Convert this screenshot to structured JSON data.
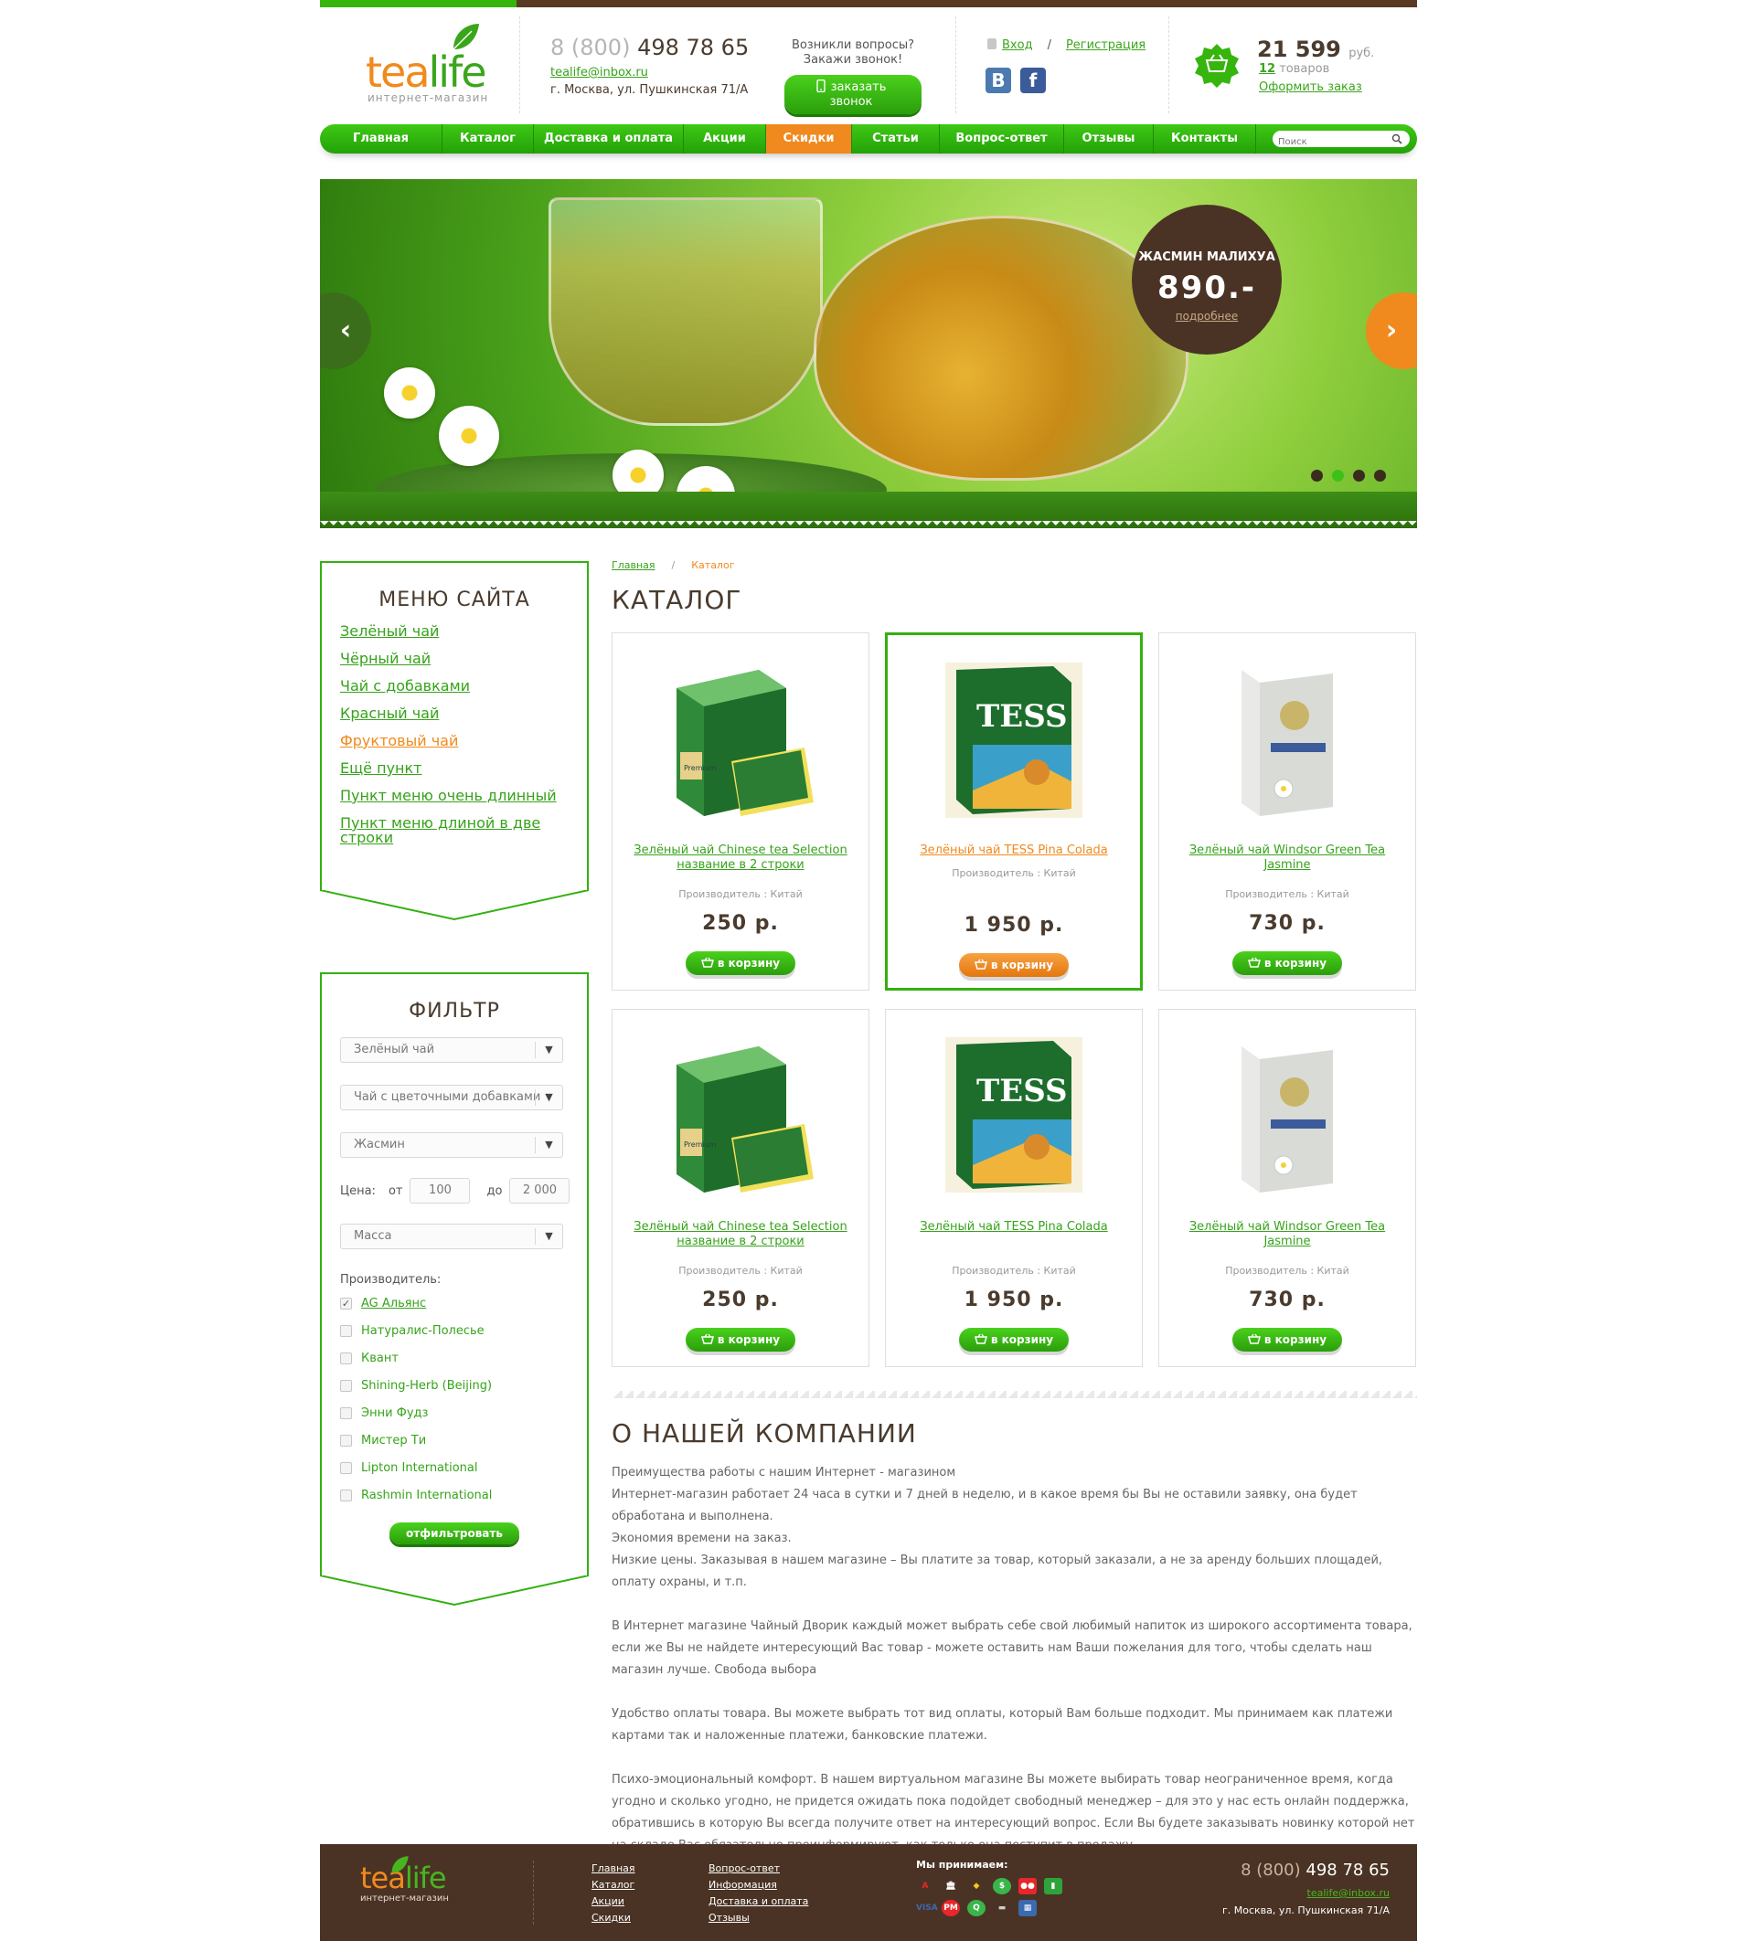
{
  "header": {
    "logo": {
      "part1": "tea",
      "part2": "life",
      "subtitle": "интернет-магазин"
    },
    "phone_prefix": "8 (800)",
    "phone_number": "498 78 65",
    "email": "tealife@inbox.ru",
    "address": "г. Москва, ул. Пушкинская 71/А",
    "callback_text_1": "Возникли вопросы?",
    "callback_text_2": "Закажи звонок!",
    "callback_button": "заказать звонок",
    "login": "Вход",
    "register": "Регистрация",
    "social": {
      "vk": "В",
      "fb": "f"
    },
    "cart": {
      "sum": "21 599",
      "currency": "руб.",
      "count": "12",
      "count_label": "товаров",
      "order_link": "Оформить заказ"
    }
  },
  "nav": {
    "items": [
      "Главная",
      "Каталог",
      "Доставка и оплата",
      "Акции",
      "Скидки",
      "Статьи",
      "Вопрос-ответ",
      "Отзывы",
      "Контакты"
    ],
    "active_index": 4,
    "search_placeholder": "Поиск"
  },
  "slider": {
    "promo_name": "ЖАСМИН МАЛИХУА",
    "promo_price": "890.-",
    "promo_more": "подробнее",
    "prev_label": "‹",
    "next_label": "›",
    "active_dot": 1
  },
  "sidebar": {
    "menu_title": "МЕНЮ САЙТА",
    "menu_items": [
      "Зелёный чай",
      "Чёрный чай",
      "Чай с добавками",
      "Красный чай",
      "Фруктовый чай",
      "Ещё пункт",
      "Пункт меню очень длинный",
      "Пункт меню длиной в две строки"
    ],
    "menu_active_index": 4,
    "filter_title": "ФИЛЬТР",
    "select_1": "Зелёный чай",
    "select_2": "Чай с цветочными добавками",
    "select_3": "Жасмин",
    "price_label": "Цена:",
    "price_from_label": "от",
    "price_from": "100",
    "price_to_label": "до",
    "price_to": "2 000",
    "select_4": "Масса",
    "makers_title": "Производитель:",
    "makers": [
      "AG Альянс",
      "Натуралис-Полесье",
      "Квант",
      "Shining-Herb (Beijing)",
      "Энни Фудз",
      "Мистер Ти",
      "Lipton International",
      "Rashmin International"
    ],
    "makers_checked_index": 0,
    "filter_button": "отфильтровать"
  },
  "breadcrumb": {
    "home": "Главная",
    "separator": "/",
    "current": "Каталог"
  },
  "catalog_title": "КАТАЛОГ",
  "products": [
    {
      "title": "Зелёный чай Chinese tea Selection название в 2 строки",
      "maker": "Производитель : Китай",
      "price": "250 р.",
      "buy": "в корзину",
      "kind": "chinese"
    },
    {
      "title": "Зелёный чай TESS Pina Colada",
      "maker": "Производитель : Китай",
      "price": "1 950 р.",
      "buy": "в корзину",
      "kind": "tess"
    },
    {
      "title": "Зелёный чай Windsor Green Tea Jasmine",
      "maker": "Производитель : Китай",
      "price": "730 р.",
      "buy": "в корзину",
      "kind": "windsor"
    },
    {
      "title": "Зелёный чай Chinese tea Selection название в 2 строки",
      "maker": "Производитель : Китай",
      "price": "250 р.",
      "buy": "в корзину",
      "kind": "chinese"
    },
    {
      "title": "Зелёный чай TESS Pina Colada",
      "maker": "Производитель : Китай",
      "price": "1 950 р.",
      "buy": "в корзину",
      "kind": "tess"
    },
    {
      "title": "Зелёный чай Windsor Green Tea Jasmine",
      "maker": "Производитель : Китай",
      "price": "730 р.",
      "buy": "в корзину",
      "kind": "windsor"
    }
  ],
  "highlighted_product_index": 1,
  "about": {
    "title": "О НАШЕЙ КОМПАНИИ",
    "p1": " Преимущества работы с нашим Интернет - магазином",
    "p2": "Интернет-магазин работает 24 часа в сутки и 7 дней в неделю, и в какое время бы Вы не оставили заявку, она будет обработана и выполнена.",
    "p3": "Экономия времени на заказ.",
    "p4": " Низкие цены. Заказывая в нашем магазине – Вы платите за товар, который заказали, а не за аренду больших площадей, оплату охраны, и т.п.",
    "p5": "В Интернет магазине Чайный Дворик каждый может выбрать себе свой любимый напиток из широкого ассортимента товара, если же Вы не найдете интересующий Вас товар - можете оставить нам Ваши пожелания для того, чтобы сделать наш магазин лучше. Свобода выбора",
    "p6": "Удобство оплаты товара. Вы можете выбрать тот вид оплаты, который Вам больше подходит. Мы принимаем как платежи картами так и наложенные платежи, банковские платежи.",
    "p7": "Психо-эмоциональный комфорт. В нашем виртуальном магазине Вы можете выбирать товар неограниченное время, когда угодно и сколько угодно, не придется ожидать пока подойдет свободный менеджер – для это у нас есть онлайн поддержка, обратившись в которую Вы всегда получите ответ на интересующий вопрос. Если Вы будете заказывать новинку которой нет на складе Вас обязательно проинформируют, как только она поступит в продажу."
  },
  "footer": {
    "logo": {
      "part1": "tea",
      "part2": "life",
      "subtitle": "интернет-магазин"
    },
    "col1": [
      "Главная",
      "Каталог",
      "Акции",
      "Скидки"
    ],
    "col2": [
      "Вопрос-ответ",
      "Информация",
      "Доставка и оплата",
      "Отзывы"
    ],
    "pay_title": "Мы принимаем:",
    "pay_icons": [
      "alfa-bank-icon",
      "bank-icon",
      "yandex-money-icon",
      "webmoney-icon",
      "mastercard-icon",
      "privat-icon",
      "visa-icon",
      "rbk-money-icon",
      "qiwi-icon",
      "terminal-icon",
      "card-icon"
    ],
    "phone_prefix": "8 (800)",
    "phone_number": "498 78 65",
    "email": "tealife@inbox.ru",
    "address": "г. Москва, ул. Пушкинская 71/А"
  }
}
